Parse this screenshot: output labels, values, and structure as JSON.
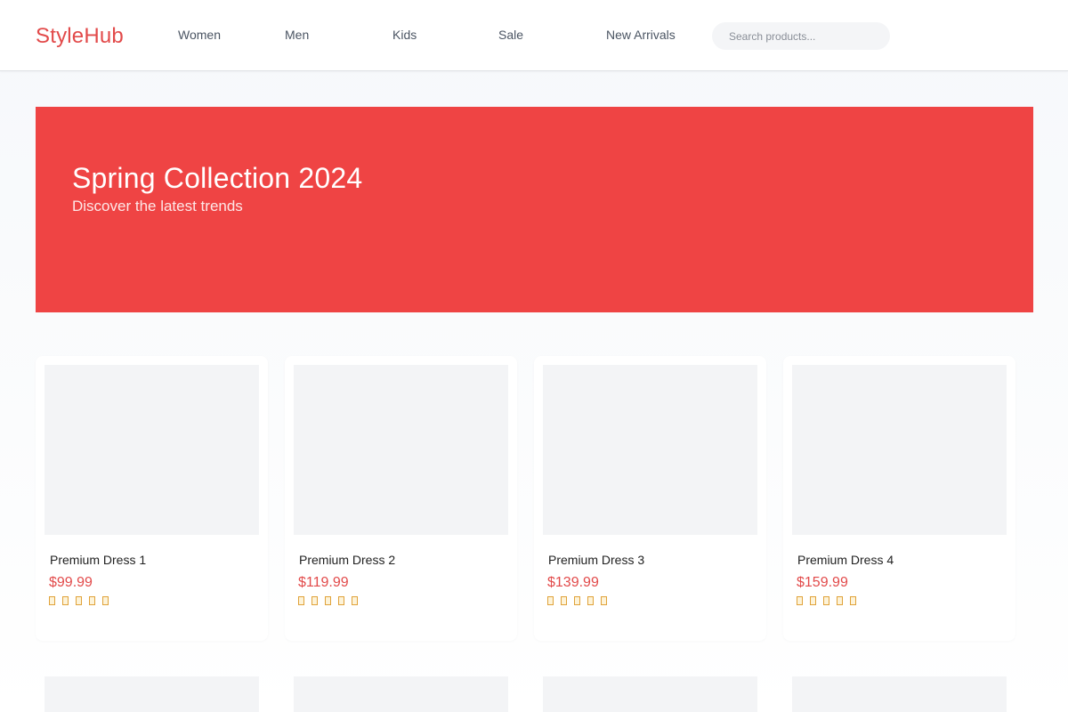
{
  "header": {
    "logo": "StyleHub",
    "nav": [
      "Women",
      "Men",
      "Kids",
      "Sale",
      "New Arrivals"
    ],
    "search_placeholder": "Search products..."
  },
  "hero": {
    "title": "Spring Collection 2024",
    "subtitle": "Discover the latest trends"
  },
  "products": [
    {
      "name": "Premium Dress 1",
      "price": "$99.99",
      "rating_stars": 5
    },
    {
      "name": "Premium Dress 2",
      "price": "$119.99",
      "rating_stars": 5
    },
    {
      "name": "Premium Dress 3",
      "price": "$139.99",
      "rating_stars": 5
    },
    {
      "name": "Premium Dress 4",
      "price": "$159.99",
      "rating_stars": 5
    }
  ],
  "colors": {
    "accent": "#ef4444",
    "logo": "#e24a4a",
    "star": "#e0a23a"
  }
}
